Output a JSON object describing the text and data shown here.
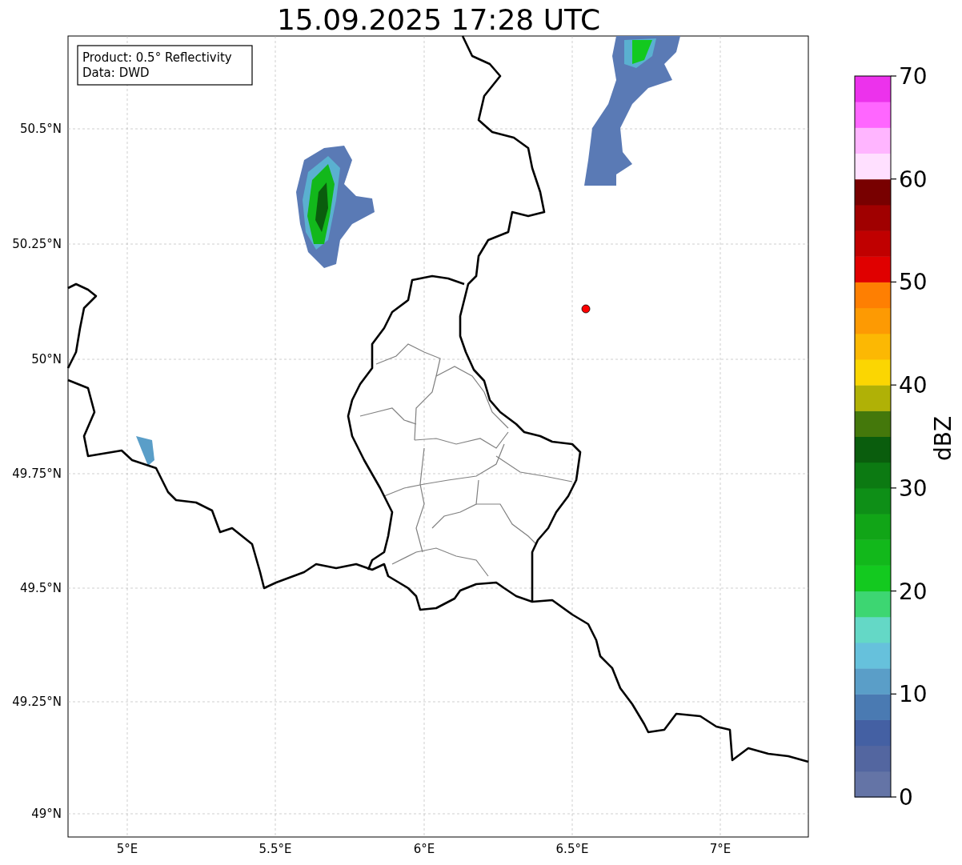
{
  "title": "15.09.2025 17:28 UTC",
  "info_box": [
    "Product: 0.5° Reflectivity",
    "Data: DWD"
  ],
  "map": {
    "x_tick_labels": [
      "5°E",
      "5.5°E",
      "6°E",
      "6.5°E",
      "7°E"
    ],
    "y_tick_labels": [
      "50.5°N",
      "50.25°N",
      "50°N",
      "49.75°N",
      "49.5°N",
      "49.25°N",
      "49°N"
    ]
  },
  "colorbar": {
    "label": "dBZ",
    "tick_labels": [
      "70",
      "60",
      "50",
      "40",
      "30",
      "20",
      "10",
      "0"
    ],
    "segments": [
      {
        "color": "#6474a6"
      },
      {
        "color": "#5366a0"
      },
      {
        "color": "#4460a3"
      },
      {
        "color": "#4a7ab2"
      },
      {
        "color": "#5a9ec8"
      },
      {
        "color": "#66c1dc"
      },
      {
        "color": "#64d8c6"
      },
      {
        "color": "#3dd672"
      },
      {
        "color": "#13c91f"
      },
      {
        "color": "#12b81b"
      },
      {
        "color": "#11a517"
      },
      {
        "color": "#0e8f17"
      },
      {
        "color": "#0c7a12"
      },
      {
        "color": "#0a5d0d"
      },
      {
        "color": "#44780b"
      },
      {
        "color": "#b0b106"
      },
      {
        "color": "#fbd602"
      },
      {
        "color": "#fcb803"
      },
      {
        "color": "#fd9a03"
      },
      {
        "color": "#fe7f02"
      },
      {
        "color": "#e00000"
      },
      {
        "color": "#c00000"
      },
      {
        "color": "#a00000"
      },
      {
        "color": "#780000"
      },
      {
        "color": "#ffe0ff"
      },
      {
        "color": "#ffb5ff"
      },
      {
        "color": "#ff66ff"
      },
      {
        "color": "#ec32ec"
      }
    ]
  }
}
